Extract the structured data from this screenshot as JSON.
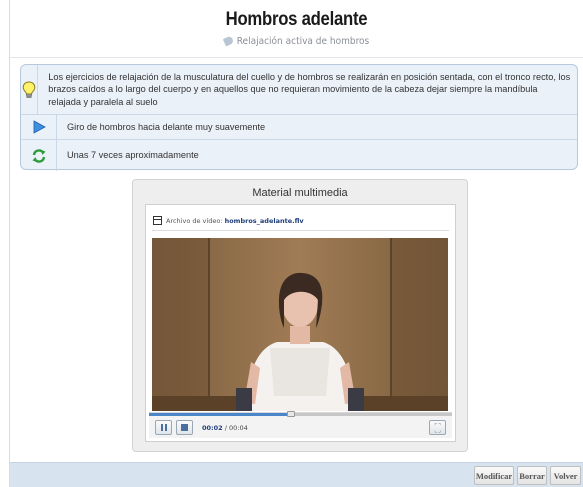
{
  "header": {
    "title": "Hombros adelante",
    "subtitle": "Relajación activa de hombros",
    "subtitle_icon": "tag-icon"
  },
  "instructions": [
    {
      "icon": "lightbulb-icon",
      "text": "Los ejercicios de relajación de la musculatura del cuello y de hombros se realizarán en posición sentada, con el tronco recto, los brazos caídos a lo largo del cuerpo y en aquellos que no requieran movimiento de la cabeza dejar siempre la mandíbula relajada y paralela al suelo"
    },
    {
      "icon": "play-arrow-icon",
      "text": "Giro de hombros hacia delante muy suavemente"
    },
    {
      "icon": "repeat-arrows-icon",
      "text": "Unas 7 veces aproximadamente"
    }
  ],
  "media": {
    "title": "Material multimedia",
    "file_label": "Archivo de vídeo:",
    "file_name": "hombros_adelante.flv",
    "time_current": "00:02",
    "time_separator": " / ",
    "time_total": "00:04",
    "progress_fraction": 0.47
  },
  "footer": {
    "modify_label": "Modificar",
    "delete_label": "Borrar",
    "back_label": "Volver"
  },
  "colors": {
    "accent_blue": "#4a86c8",
    "info_bg": "#eaf1f9",
    "footer_bg": "#d7e3ef"
  }
}
